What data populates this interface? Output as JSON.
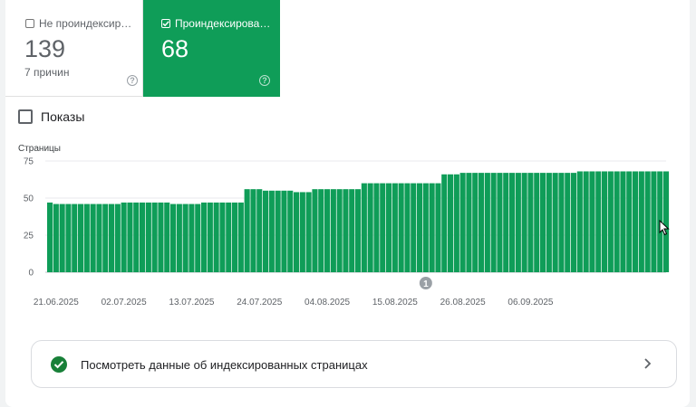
{
  "tiles": {
    "not_indexed": {
      "label": "Не проиндексир…",
      "value": "139",
      "subtitle": "7 причин",
      "help": "?"
    },
    "indexed": {
      "label": "Проиндексирова…",
      "value": "68",
      "help": "?"
    }
  },
  "impressions": {
    "label": "Показы"
  },
  "link_card": {
    "label": "Посмотреть данные об индексированных страницах"
  },
  "colors": {
    "indexed_green": "#0f9d58",
    "bar_green": "#0f9d58",
    "check_green": "#188038"
  },
  "chart_data": {
    "type": "bar",
    "ylabel": "Страницы",
    "ylim": [
      0,
      75
    ],
    "yticks": [
      0,
      25,
      50,
      75
    ],
    "x_ticks": [
      "21.06.2025",
      "02.07.2025",
      "13.07.2025",
      "24.07.2025",
      "04.08.2025",
      "15.08.2025",
      "26.08.2025",
      "06.09.2025"
    ],
    "start_date": "20.06.2025",
    "series": [
      {
        "values": [
          47,
          46,
          46,
          46,
          46,
          46,
          46,
          46,
          46,
          46,
          46,
          46,
          47,
          47,
          47,
          47,
          47,
          47,
          47,
          47,
          46,
          46,
          46,
          46,
          46,
          47,
          47,
          47,
          47,
          47,
          47,
          47,
          56,
          56,
          56,
          55,
          55,
          55,
          55,
          55,
          54,
          54,
          54,
          56,
          56,
          56,
          56,
          56,
          56,
          56,
          56,
          60,
          60,
          60,
          60,
          60,
          60,
          60,
          60,
          60,
          60,
          60,
          60,
          60,
          66,
          66,
          66,
          67,
          67,
          67,
          67,
          67,
          67,
          67,
          67,
          67,
          67,
          67,
          67,
          67,
          67,
          67,
          67,
          67,
          67,
          67,
          68,
          68,
          68,
          68,
          68,
          68,
          68,
          68,
          68,
          68,
          68,
          68,
          68,
          68,
          68
        ]
      }
    ],
    "annotations": [
      {
        "label": "1",
        "date": "20.08.2025"
      }
    ],
    "grid": true
  }
}
